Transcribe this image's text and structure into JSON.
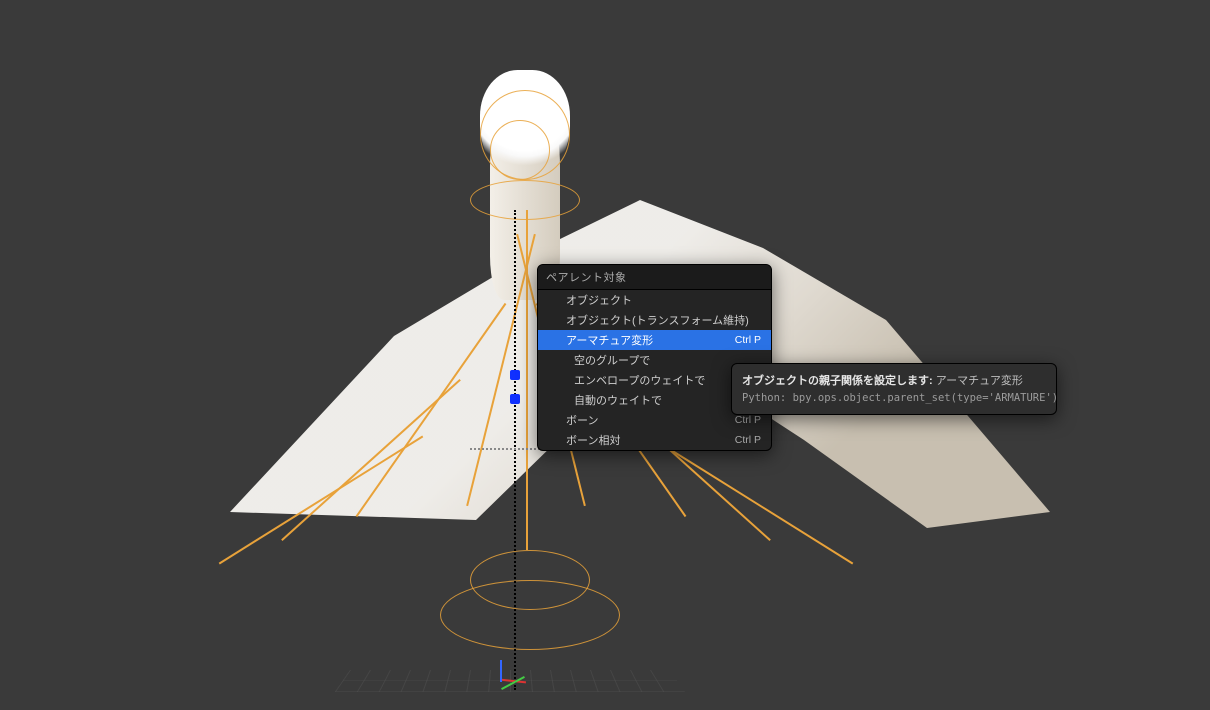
{
  "viewport": {
    "background": "#3a3a3a"
  },
  "menu": {
    "header": "ペアレント対象",
    "items": [
      {
        "label": "オブジェクト",
        "shortcut": "",
        "highlighted": false,
        "indent": false
      },
      {
        "label": "オブジェクト(トランスフォーム維持)",
        "shortcut": "",
        "highlighted": false,
        "indent": false
      },
      {
        "label": "アーマチュア変形",
        "shortcut": "Ctrl P",
        "highlighted": true,
        "indent": false
      },
      {
        "label": "空のグループで",
        "shortcut": "",
        "highlighted": false,
        "indent": true
      },
      {
        "label": "エンベロープのウェイトで",
        "shortcut": "",
        "highlighted": false,
        "indent": true
      },
      {
        "label": "自動のウェイトで",
        "shortcut": "",
        "highlighted": false,
        "indent": true
      },
      {
        "label": "ボーン",
        "shortcut": "Ctrl P",
        "highlighted": false,
        "indent": false
      },
      {
        "label": "ボーン相対",
        "shortcut": "Ctrl P",
        "highlighted": false,
        "indent": false
      }
    ]
  },
  "tooltip": {
    "title_label": "オブジェクトの親子関係を設定します:",
    "title_value": "アーマチュア変形",
    "python_prefix": "Python:",
    "python_code": "bpy.ops.object.parent_set(type='ARMATURE')"
  },
  "ghost_shortcuts": {
    "a": "Ctrl P",
    "b": "Ctrl P"
  }
}
